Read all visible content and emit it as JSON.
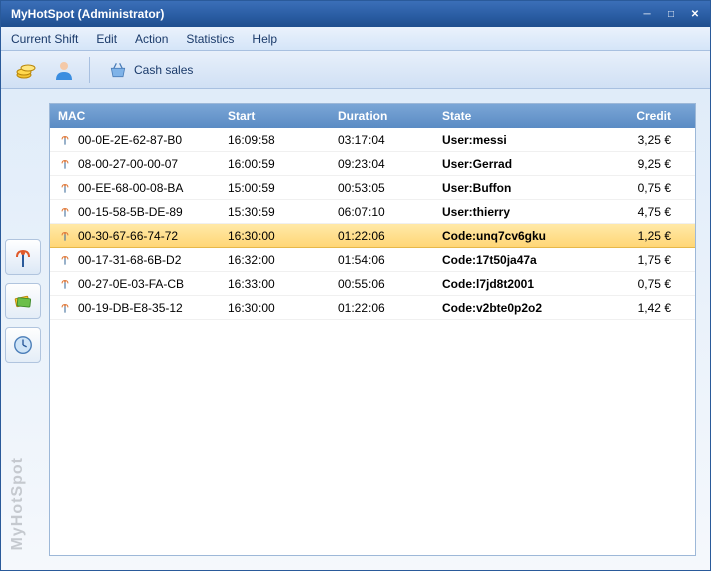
{
  "title": "MyHotSpot  (Administrator)",
  "menu": {
    "shift": "Current Shift",
    "edit": "Edit",
    "action": "Action",
    "stats": "Statistics",
    "help": "Help"
  },
  "toolbar": {
    "cash_label": "Cash sales"
  },
  "brand_vertical": "MyHotSpot",
  "columns": {
    "mac": "MAC",
    "start": "Start",
    "duration": "Duration",
    "state": "State",
    "credit": "Credit"
  },
  "rows": [
    {
      "mac": "00-0E-2E-62-87-B0",
      "start": "16:09:58",
      "duration": "03:17:04",
      "state": "User:messi",
      "credit": "3,25 €",
      "selected": false
    },
    {
      "mac": "08-00-27-00-00-07",
      "start": "16:00:59",
      "duration": "09:23:04",
      "state": "User:Gerrad",
      "credit": "9,25 €",
      "selected": false
    },
    {
      "mac": "00-EE-68-00-08-BA",
      "start": "15:00:59",
      "duration": "00:53:05",
      "state": "User:Buffon",
      "credit": "0,75 €",
      "selected": false
    },
    {
      "mac": "00-15-58-5B-DE-89",
      "start": "15:30:59",
      "duration": "06:07:10",
      "state": "User:thierry",
      "credit": "4,75 €",
      "selected": false
    },
    {
      "mac": "00-30-67-66-74-72",
      "start": "16:30:00",
      "duration": "01:22:06",
      "state": "Code:unq7cv6gku",
      "credit": "1,25 €",
      "selected": true
    },
    {
      "mac": "00-17-31-68-6B-D2",
      "start": "16:32:00",
      "duration": "01:54:06",
      "state": "Code:17t50ja47a",
      "credit": "1,75 €",
      "selected": false
    },
    {
      "mac": "00-27-0E-03-FA-CB",
      "start": "16:33:00",
      "duration": "00:55:06",
      "state": "Code:l7jd8t2001",
      "credit": "0,75 €",
      "selected": false
    },
    {
      "mac": "00-19-DB-E8-35-12",
      "start": "16:30:00",
      "duration": "01:22:06",
      "state": "Code:v2bte0p2o2",
      "credit": "1,42 €",
      "selected": false
    }
  ]
}
